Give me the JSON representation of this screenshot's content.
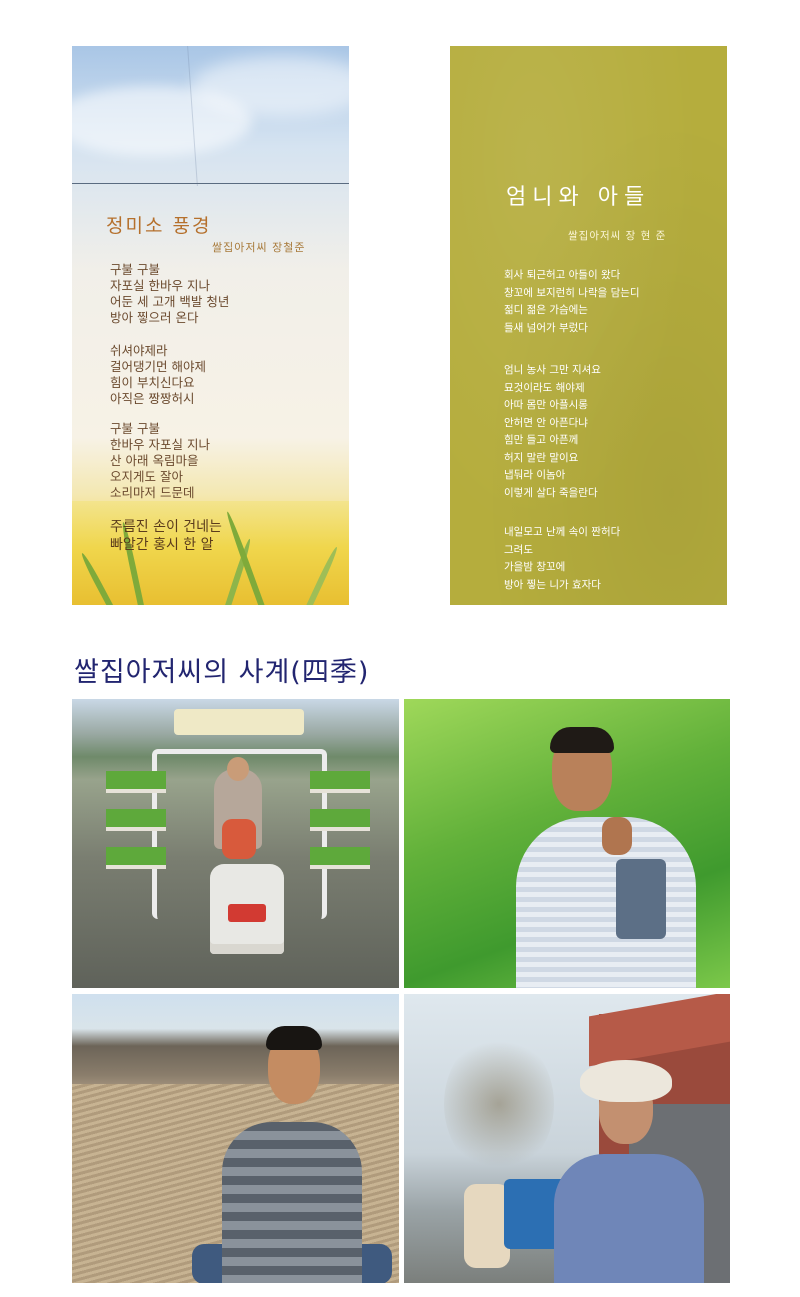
{
  "poem_left": {
    "title": "정미소 풍경",
    "author": "쌀집아저씨 장철준",
    "stanza1": [
      "구불 구불",
      "자포실 한바우 지나",
      "어둔 세 고개 백발 청년",
      "방아 찧으러 온다"
    ],
    "stanza2": [
      "쉬셔야제라",
      "걸어댕기먼 해야제",
      "힘이 부치신다요",
      "아직은 짱짱허시"
    ],
    "stanza3": [
      "구불 구불",
      "한바우 자포실 지나",
      "산 아래 옥림마을",
      "오지게도 잘아",
      "소리마저 드문데"
    ],
    "stanza4": [
      "주름진 손이 건네는",
      "빠알간 홍시 한 알"
    ]
  },
  "poem_right": {
    "title": "엄니와 아들",
    "author": "쌀집아저씨 장 현 준",
    "stanza1": [
      "회사 퇴근허고 아들이 왔다",
      "창꼬에 보지런히 나락을 담는디",
      "젊디 젊은 가슴에는",
      "들새 넘어가 부렀다"
    ],
    "stanza2": [
      "엄니 농사 그만 지셔요",
      "묘것이라도 해야제",
      "아따 몸만 아플시롱",
      "안허면 안 아픈다냐",
      "힘만 들고 아픈께",
      "허지 말란 말이요",
      "냅둬라 이놈아",
      "이렇게 살다 죽을란다"
    ],
    "stanza3": [
      "내일모고 난께 속이 짠허다",
      "그려도",
      "가을밤 창꼬에",
      "방아 찧는 니가 효자다"
    ]
  },
  "section": {
    "title": "쌀집아저씨의 사계(四季)"
  },
  "photos": [
    {
      "name": "spring-photo",
      "subject": "rice-transplanter"
    },
    {
      "name": "summer-photo",
      "subject": "man-in-paddy"
    },
    {
      "name": "autumn-photo",
      "subject": "man-in-harvested-field"
    },
    {
      "name": "winter-photo",
      "subject": "man-at-mill"
    }
  ],
  "colors": {
    "section_title": "#222570",
    "right_panel": "#b5ad3d"
  }
}
